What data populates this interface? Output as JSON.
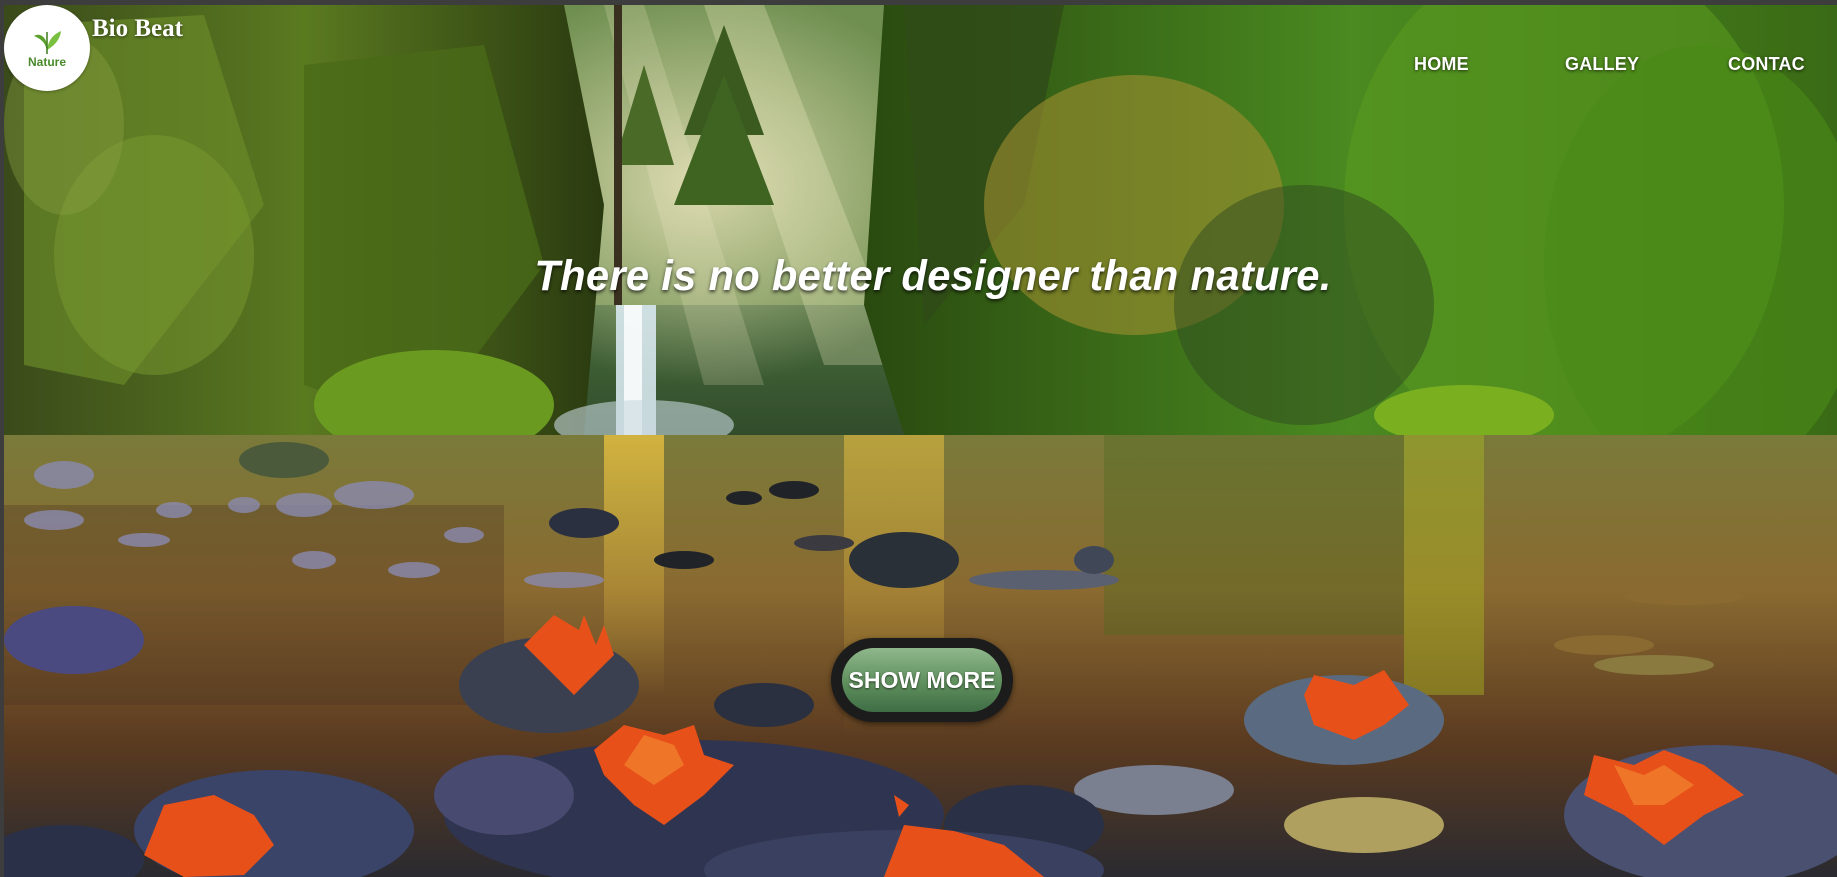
{
  "brand": {
    "logo_text": "Nature",
    "name": "Bio Beat"
  },
  "nav": {
    "items": [
      "HOME",
      "GALLEY",
      "CONTAC"
    ]
  },
  "hero": {
    "headline": "There is no better designer than nature.",
    "cta_label": "SHOW MORE"
  },
  "colors": {
    "nav_text": "#ffffff",
    "button_outer": "#1c1c1c",
    "button_fill": "#6e9a6a",
    "logo_green": "#4a8a2a"
  },
  "icons": {
    "logo": "leaf-icon"
  }
}
